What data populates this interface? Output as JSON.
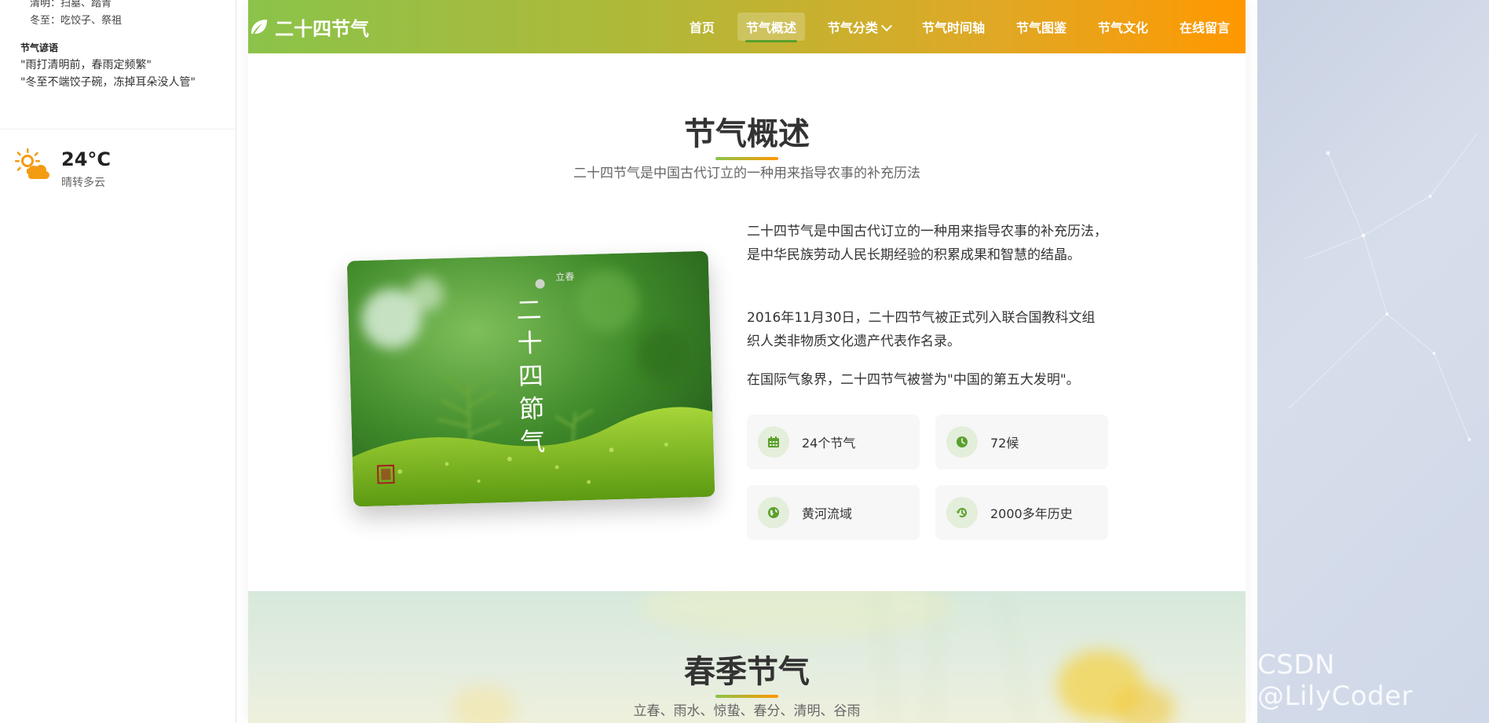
{
  "sidebar": {
    "customs": [
      "清明：扫墓、踏青",
      "冬至：吃饺子、祭祖"
    ],
    "sayings_heading": "节气谚语",
    "sayings": [
      "\"雨打清明前，春雨定频繁\"",
      "\"冬至不端饺子碗，冻掉耳朵没人管\""
    ],
    "weather": {
      "temp": "24°C",
      "desc": "晴转多云",
      "icon": "sun-cloud-icon"
    }
  },
  "navbar": {
    "brand": "二十四节气",
    "items": [
      {
        "label": "首页",
        "active": false
      },
      {
        "label": "节气概述",
        "active": true
      },
      {
        "label": "节气分类",
        "active": false,
        "dropdown": true
      },
      {
        "label": "节气时间轴",
        "active": false
      },
      {
        "label": "节气图鉴",
        "active": false
      },
      {
        "label": "节气文化",
        "active": false
      },
      {
        "label": "在线留言",
        "active": false
      }
    ]
  },
  "overview": {
    "title": "节气概述",
    "subtitle": "二十四节气是中国古代订立的一种用来指导农事的补充历法",
    "image_text": {
      "small": "立春",
      "big": [
        "二",
        "十",
        "四",
        "節",
        "气"
      ]
    },
    "paragraphs": [
      "二十四节气是中国古代订立的一种用来指导农事的补充历法，是中华民族劳动人民长期经验的积累成果和智慧的结晶。",
      "2016年11月30日，二十四节气被正式列入联合国教科文组织人类非物质文化遗产代表作名录。",
      "在国际气象界，二十四节气被誉为\"中国的第五大发明\"。"
    ],
    "stats": [
      {
        "label": "24个节气",
        "icon": "calendar-icon"
      },
      {
        "label": "72候",
        "icon": "clock-icon"
      },
      {
        "label": "黄河流域",
        "icon": "globe-icon"
      },
      {
        "label": "2000多年历史",
        "icon": "history-icon"
      }
    ]
  },
  "spring": {
    "title": "春季节气",
    "subtitle": "立春、雨水、惊蛰、春分、清明、谷雨"
  },
  "watermark": "CSDN @LilyCoder",
  "colors": {
    "green": "#8bc34a",
    "orange": "#ff9800",
    "icon_green": "#5aa02c"
  }
}
